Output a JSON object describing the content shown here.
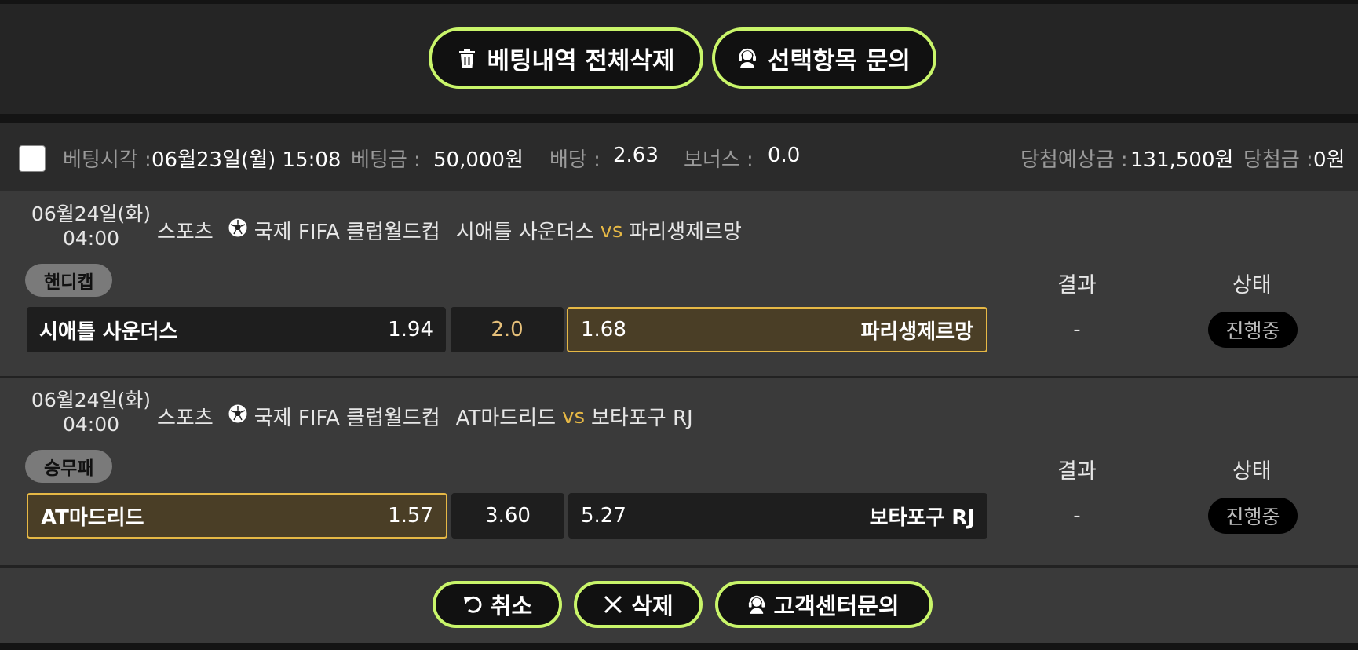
{
  "toolbar": {
    "delete_all_label": "베팅내역 전체삭제",
    "inquire_selected_label": "선택항목 문의"
  },
  "bet": {
    "time_label": "베팅시각 :",
    "time_value": "06월23일(월) 15:08",
    "amount_label": "베팅금 :",
    "amount_value": "50,000원",
    "odds_label": "배당 :",
    "odds_value": "2.63",
    "bonus_label": "보너스 :",
    "bonus_value": "0.0",
    "expected_label": "당첨예상금 :",
    "expected_value": "131,500원",
    "win_label": "당첨금 :",
    "win_value": "0원"
  },
  "matches": [
    {
      "date": "06월24일(화)",
      "time": "04:00",
      "sport": "스포츠",
      "league": "국제 FIFA 클럽월드컵",
      "home": "시애틀 사운더스",
      "vs": "vs",
      "away": "파리생제르망",
      "market": "핸디캡",
      "result_header": "결과",
      "status_header": "상태",
      "home_name": "시애틀 사운더스",
      "home_odds": "1.94",
      "middle": "2.0",
      "away_odds": "1.68",
      "away_name": "파리생제르망",
      "selected": "away",
      "result": "-",
      "status": "진행중"
    },
    {
      "date": "06월24일(화)",
      "time": "04:00",
      "sport": "스포츠",
      "league": "국제 FIFA 클럽월드컵",
      "home": "AT마드리드",
      "vs": "vs",
      "away": "보타포구 RJ",
      "market": "승무패",
      "result_header": "결과",
      "status_header": "상태",
      "home_name": "AT마드리드",
      "home_odds": "1.57",
      "middle": "3.60",
      "away_odds": "5.27",
      "away_name": "보타포구 RJ",
      "selected": "home",
      "result": "-",
      "status": "진행중"
    }
  ],
  "footer": {
    "cancel_label": "취소",
    "delete_label": "삭제",
    "support_label": "고객센터문의"
  },
  "colors": {
    "accent": "#c9f56a",
    "selected_border": "#e6b845",
    "vs": "#e6b845"
  }
}
